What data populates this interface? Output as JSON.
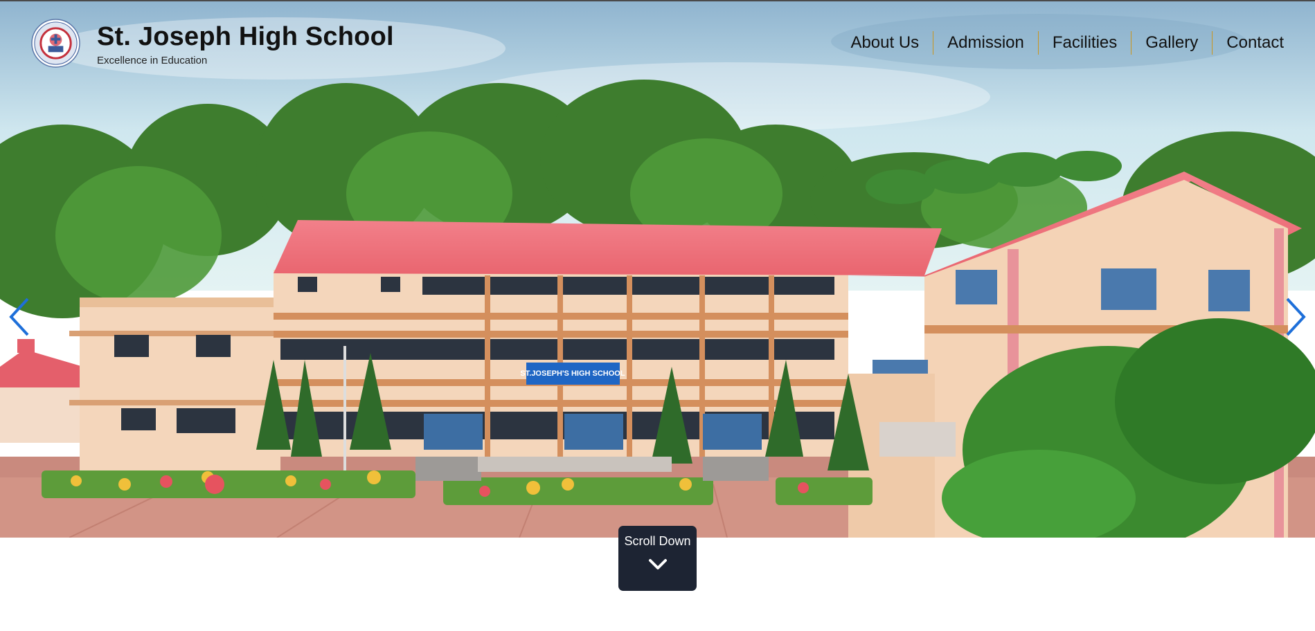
{
  "header": {
    "school_name": "St. Joseph High School",
    "tagline": "Excellence in Education",
    "logo_icon": "school-crest-logo"
  },
  "nav": {
    "items": [
      {
        "label": "About Us"
      },
      {
        "label": "Admission"
      },
      {
        "label": "Facilities"
      },
      {
        "label": "Gallery"
      },
      {
        "label": "Contact"
      }
    ],
    "separator_color": "#c9951e"
  },
  "hero": {
    "image": "school-building-photo",
    "building_sign": "ST.JOSEPH'S HIGH SCHOOL",
    "prev_icon": "chevron-left-icon",
    "next_icon": "chevron-right-icon",
    "arrow_color": "#1e6fd9"
  },
  "scroll": {
    "label": "Scroll Down",
    "icon": "chevron-down-icon",
    "background": "#1d2433"
  }
}
